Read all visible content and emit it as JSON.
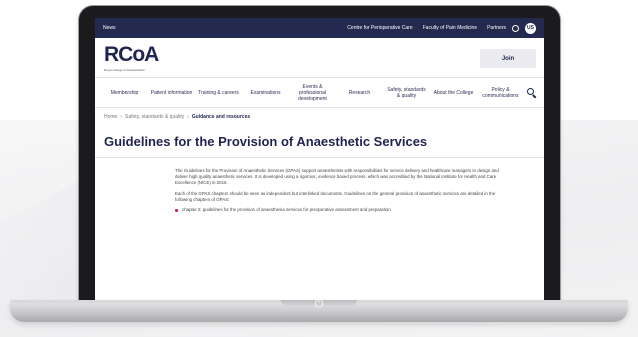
{
  "site": {
    "topbar": {
      "news": "News",
      "links": [
        "Centre for Perioperative Care",
        "Faculty of Pain Medicine",
        "Partners"
      ],
      "user_initials": "US"
    },
    "logo": {
      "text": "RCoA",
      "subtitle": "Royal College of Anaesthetists"
    },
    "join_label": "Join",
    "nav": [
      "Membership",
      "Patient information",
      "Training & careers",
      "Examinations",
      "Events & professional development",
      "Research",
      "Safety, standards & quality",
      "About the College",
      "Policy & communications"
    ],
    "breadcrumb": [
      "Home",
      "Safety, standards & quality",
      "Guidance and resources"
    ],
    "page_title": "Guidelines for the Provision of Anaesthetic Services",
    "paragraphs": [
      "The Guidelines for the Provision of Anaesthetic Services (GPAS) support anaesthetists with responsibilities for service delivery and healthcare managers to design and deliver high quality anaesthetic services. It is developed using a rigorous, evidence based process, which was accredited by the National Institute for Health and Care Excellence (NICE) in 2016.",
      "Each of the GPAS chapters should be seen as independent but interlinked documents. Guidelines on the general provision of anaesthetic services are detailed in the following chapters of GPAS:"
    ],
    "bullets": [
      "chapter 2: guidelines for the provision of anaesthesia services for preoperative assessment and preparation"
    ]
  },
  "colors": {
    "brand_navy": "#23294f",
    "accent": "#c9214b"
  }
}
